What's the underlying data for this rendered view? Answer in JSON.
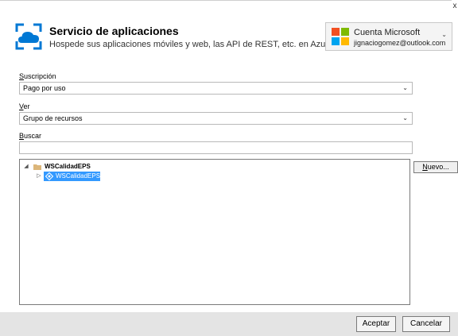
{
  "window": {
    "close_glyph": "x"
  },
  "header": {
    "title": "Servicio de aplicaciones",
    "subtitle": "Hospede sus aplicaciones móviles y web, las API de REST, etc. en Azure",
    "icon": "app-service-cloud-icon"
  },
  "account": {
    "title": "Cuenta Microsoft",
    "email": "jignaciogomez@outlook.com",
    "icon": "microsoft-logo-icon"
  },
  "subscription": {
    "label_accel": "S",
    "label_rest": "uscripción",
    "value": "Pago por uso"
  },
  "view": {
    "label_accel": "V",
    "label_rest": "er",
    "value": "Grupo de recursos"
  },
  "search": {
    "label_accel": "B",
    "label_rest": "uscar",
    "value": ""
  },
  "tree": {
    "groups": [
      {
        "label": "WSCalidadEPS",
        "expanded": true,
        "children": [
          {
            "label": "WSCalidadEPS",
            "selected": true
          }
        ]
      }
    ]
  },
  "buttons": {
    "new_accel": "N",
    "new_rest": "uevo...",
    "ok": "Aceptar",
    "cancel": "Cancelar"
  },
  "colors": {
    "selection": "#3399ff",
    "azure_blue": "#0078d4",
    "footer_bg": "#e4e4e4"
  }
}
